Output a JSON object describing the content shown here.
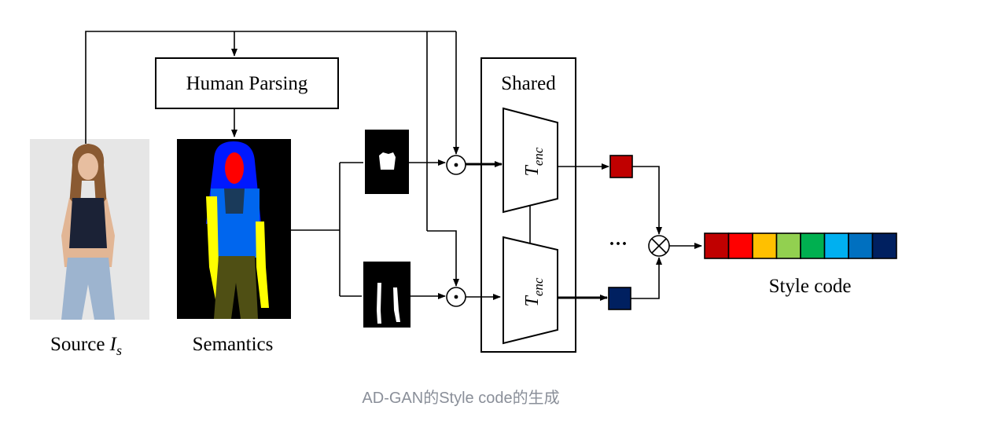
{
  "labels": {
    "human_parsing": "Human Parsing",
    "shared": "Shared",
    "encoder_symbol": "T",
    "encoder_subscript": "enc",
    "source_prefix": "Source ",
    "source_symbol": "I",
    "source_subscript": "s",
    "semantics": "Semantics",
    "ellipsis": "···",
    "style_code": "Style code"
  },
  "operators": {
    "elementwise_product": "⊙",
    "combine": "⊗"
  },
  "style_code_colors": [
    "#c00000",
    "#ff0000",
    "#ffc000",
    "#92d050",
    "#00b050",
    "#00b0f0",
    "#0070c0",
    "#002060"
  ],
  "style_vector_colors": {
    "top": "#c00000",
    "bottom": "#002060"
  },
  "caption": "AD-GAN的Style code的生成"
}
